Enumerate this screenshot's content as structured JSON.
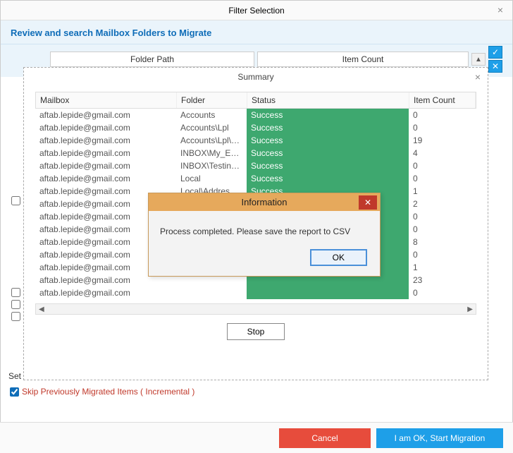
{
  "window": {
    "title": "Filter Selection",
    "subtitle": "Review and search Mailbox Folders to Migrate"
  },
  "filterHeaders": {
    "folderPath": "Folder Path",
    "itemCount": "Item Count"
  },
  "summary": {
    "title": "Summary",
    "headers": {
      "mailbox": "Mailbox",
      "folder": "Folder",
      "status": "Status",
      "itemCount": "Item Count"
    },
    "rows": [
      {
        "mailbox": "aftab.lepide@gmail.com",
        "folder": "Accounts",
        "status": "Success",
        "count": "0"
      },
      {
        "mailbox": "aftab.lepide@gmail.com",
        "folder": "Accounts\\Lpl",
        "status": "Success",
        "count": "0"
      },
      {
        "mailbox": "aftab.lepide@gmail.com",
        "folder": "Accounts\\Lpl\\N...",
        "status": "Success",
        "count": "19"
      },
      {
        "mailbox": "aftab.lepide@gmail.com",
        "folder": "INBOX\\My_Emails",
        "status": "Success",
        "count": "4"
      },
      {
        "mailbox": "aftab.lepide@gmail.com",
        "folder": "INBOX\\Testing M",
        "status": "Success",
        "count": "0"
      },
      {
        "mailbox": "aftab.lepide@gmail.com",
        "folder": "Local",
        "status": "Success",
        "count": "0"
      },
      {
        "mailbox": "aftab.lepide@gmail.com",
        "folder": "Local\\Address B...",
        "status": "Success",
        "count": "1"
      },
      {
        "mailbox": "aftab.lepide@gmail.com",
        "folder": "",
        "status": "",
        "count": "2"
      },
      {
        "mailbox": "aftab.lepide@gmail.com",
        "folder": "",
        "status": "",
        "count": "0"
      },
      {
        "mailbox": "aftab.lepide@gmail.com",
        "folder": "",
        "status": "",
        "count": "0"
      },
      {
        "mailbox": "aftab.lepide@gmail.com",
        "folder": "",
        "status": "",
        "count": "8"
      },
      {
        "mailbox": "aftab.lepide@gmail.com",
        "folder": "",
        "status": "",
        "count": "0"
      },
      {
        "mailbox": "aftab.lepide@gmail.com",
        "folder": "",
        "status": "",
        "count": "1"
      },
      {
        "mailbox": "aftab.lepide@gmail.com",
        "folder": "",
        "status": "",
        "count": "23"
      },
      {
        "mailbox": "aftab.lepide@gmail.com",
        "folder": "",
        "status": "",
        "count": "0"
      }
    ],
    "stop": "Stop"
  },
  "infoDialog": {
    "title": "Information",
    "message": "Process completed. Please save the report to CSV",
    "ok": "OK"
  },
  "settingsLabel": "Set",
  "skipLabel": "Skip Previously Migrated Items ( Incremental )",
  "footer": {
    "cancel": "Cancel",
    "start": "I am OK, Start Migration"
  }
}
